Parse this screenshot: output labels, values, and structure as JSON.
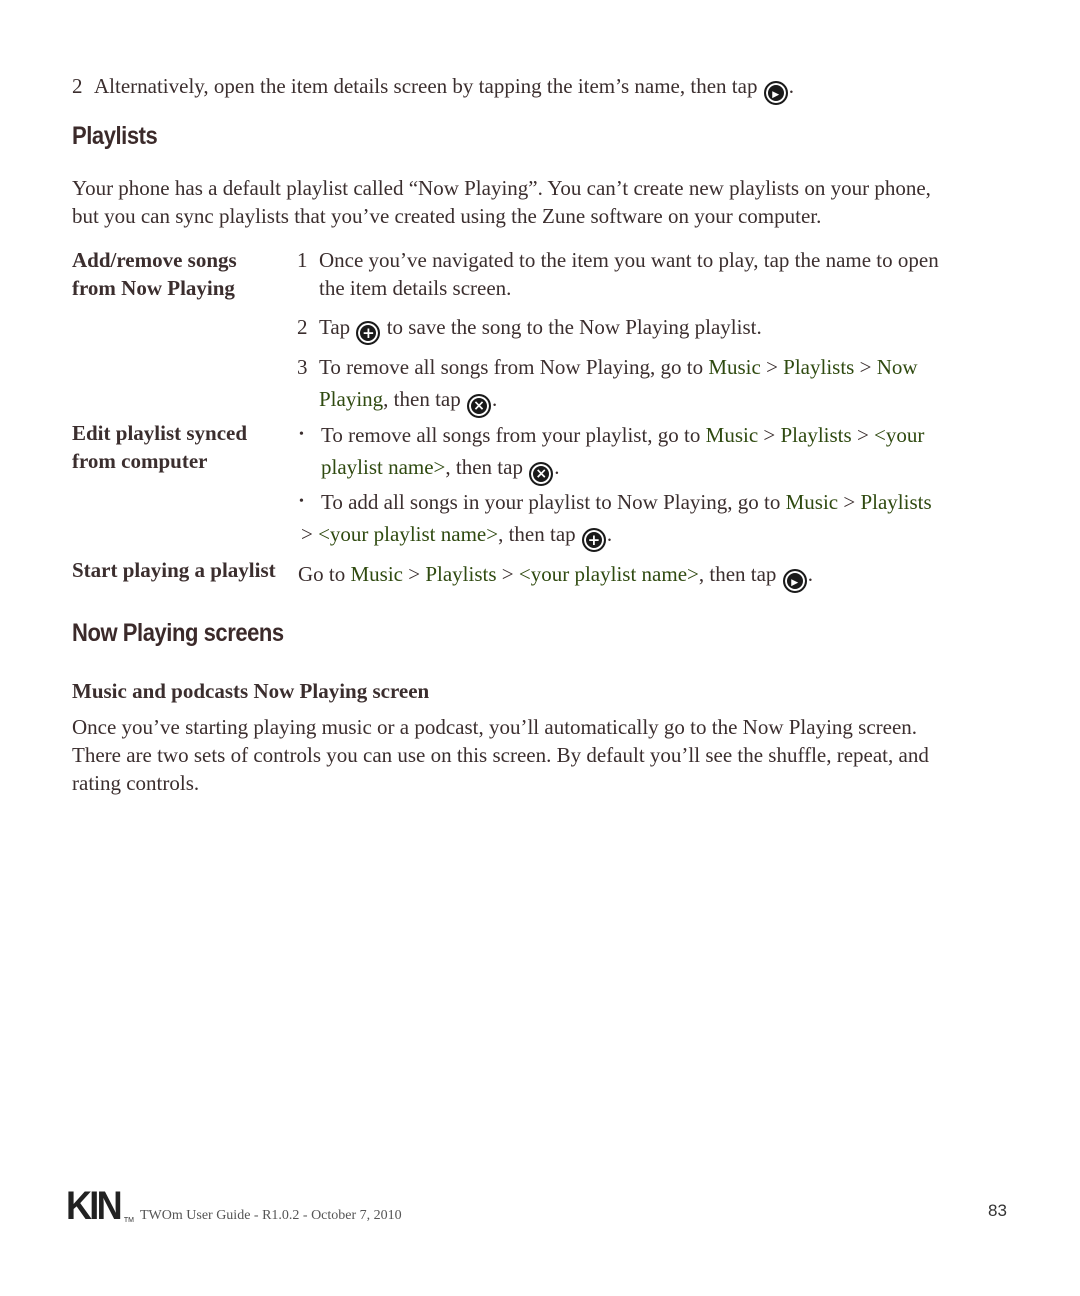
{
  "intro_step": {
    "number": "2",
    "text": "Alternatively, open the item details screen by tapping the item’s name, then tap",
    "icon": "play-icon",
    "end": "."
  },
  "playlists": {
    "heading": "Playlists",
    "paragraph_line1": "Your phone has a default playlist called “Now Playing”. You can’t create new playlists on your phone,",
    "paragraph_line2": "but you can sync playlists that you’ve created using the Zune software on your computer.",
    "add_remove": {
      "label_line1": "Add/remove songs",
      "label_line2": "from Now Playing",
      "step1_num": "1",
      "step1_line1": "Once you’ve navigated to the item you want to play, tap the name to open",
      "step1_line2": "the item details screen.",
      "step2_num": "2",
      "step2_pre": "Tap",
      "step2_icon": "add-icon",
      "step2_post": "to save the song to the Now Playing playlist.",
      "step3_num": "3",
      "step3_pre": "To remove all songs from Now Playing, go to",
      "step3_link1": "Music",
      "step3_sep1": ">",
      "step3_link2": "Playlists",
      "step3_sep2": ">",
      "step3_link3a": "Now",
      "step3_link3b": "Playing",
      "step3_post": ", then tap",
      "step3_icon": "remove-icon",
      "step3_end": "."
    },
    "edit_synced": {
      "label_line1": "Edit playlist synced",
      "label_line2": "from computer",
      "bullet": "•",
      "b1_pre": "To remove all songs from your playlist, go to",
      "b1_link1": "Music",
      "b1_sep1": ">",
      "b1_link2": "Playlists",
      "b1_sep2": ">",
      "b1_link3a": "<your",
      "b1_link3b": "playlist name>",
      "b1_post": ", then tap",
      "b1_icon": "remove-icon",
      "b1_end": ".",
      "b2_pre": "To add all songs in your playlist to Now Playing, go to",
      "b2_link1": "Music",
      "b2_sep1": ">",
      "b2_link2": "Playlists",
      "b2_sep2": ">",
      "b2_link3": "<your playlist name>",
      "b2_post": ", then tap",
      "b2_icon": "add-icon",
      "b2_end": "."
    },
    "start_playing": {
      "label": "Start playing a playlist",
      "pre": "Go to",
      "link1": "Music",
      "sep1": ">",
      "link2": "Playlists",
      "sep2": ">",
      "link3": "<your playlist name>",
      "post": ", then tap",
      "icon": "play-icon",
      "end": "."
    }
  },
  "now_playing": {
    "heading": "Now Playing screens",
    "subheading": "Music and podcasts Now Playing screen",
    "line1": "Once you’ve starting playing music or a podcast, you’ll automatically go to the Now Playing screen.",
    "line2": "There are two sets of controls you can use on this screen. By default you’ll see the shuffle, repeat, and",
    "line3": "rating controls."
  },
  "footer": {
    "logo": "KIN",
    "tm": "TM",
    "text": "TWOm User Guide - R1.0.2 - October 7, 2010",
    "page_number": "83"
  },
  "icons": {
    "play": "▶",
    "add": "+",
    "remove": "×"
  },
  "colors": {
    "text": "#3b2e2e",
    "link_green": "#2f4a10"
  }
}
